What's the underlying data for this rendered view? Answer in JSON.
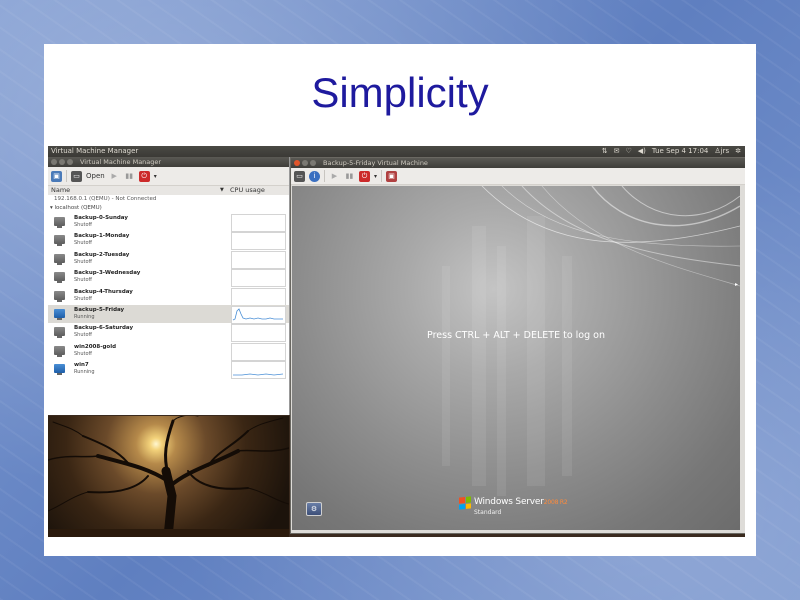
{
  "slide": {
    "title": "Simplicity"
  },
  "system_panel": {
    "app_title": "Virtual Machine Manager",
    "clock": "Tue Sep  4 17:04",
    "user": "jrs"
  },
  "vmm_window": {
    "title": "Virtual Machine Manager",
    "toolbar": {
      "open_label": "Open"
    },
    "columns": {
      "name": "Name",
      "cpu": "CPU usage"
    },
    "connection": "192.168.0.1 (QEMU) - Not Connected",
    "host": "localhost (QEMU)",
    "vms": [
      {
        "name": "Backup-0-Sunday",
        "status": "Shutoff",
        "running": false
      },
      {
        "name": "Backup-1-Monday",
        "status": "Shutoff",
        "running": false
      },
      {
        "name": "Backup-2-Tuesday",
        "status": "Shutoff",
        "running": false
      },
      {
        "name": "Backup-3-Wednesday",
        "status": "Shutoff",
        "running": false
      },
      {
        "name": "Backup-4-Thursday",
        "status": "Shutoff",
        "running": false
      },
      {
        "name": "Backup-5-Friday",
        "status": "Running",
        "running": true,
        "selected": true
      },
      {
        "name": "Backup-6-Saturday",
        "status": "Shutoff",
        "running": false
      },
      {
        "name": "win2008-gold",
        "status": "Shutoff",
        "running": false
      },
      {
        "name": "win7",
        "status": "Running",
        "running": true
      }
    ]
  },
  "vm_window": {
    "title": "Backup-5-Friday Virtual Machine",
    "guest": {
      "logon_prompt": "Press CTRL + ALT + DELETE to log on",
      "brand": "Windows Server",
      "version": "2008 R2",
      "edition": "Standard"
    }
  },
  "colors": {
    "slide_title": "#1e1a9e",
    "close_button": "#e0542a",
    "sparkline": "#4a8fd6",
    "win_version": "#ff8a3a"
  },
  "icons": [
    "monitor-icon",
    "info-icon",
    "play-icon",
    "pause-icon",
    "stats-icon",
    "power-icon",
    "dropdown-icon",
    "fullscreen-icon",
    "accessibility-icon",
    "network-icon",
    "mail-icon",
    "volume-icon",
    "gear-icon"
  ]
}
